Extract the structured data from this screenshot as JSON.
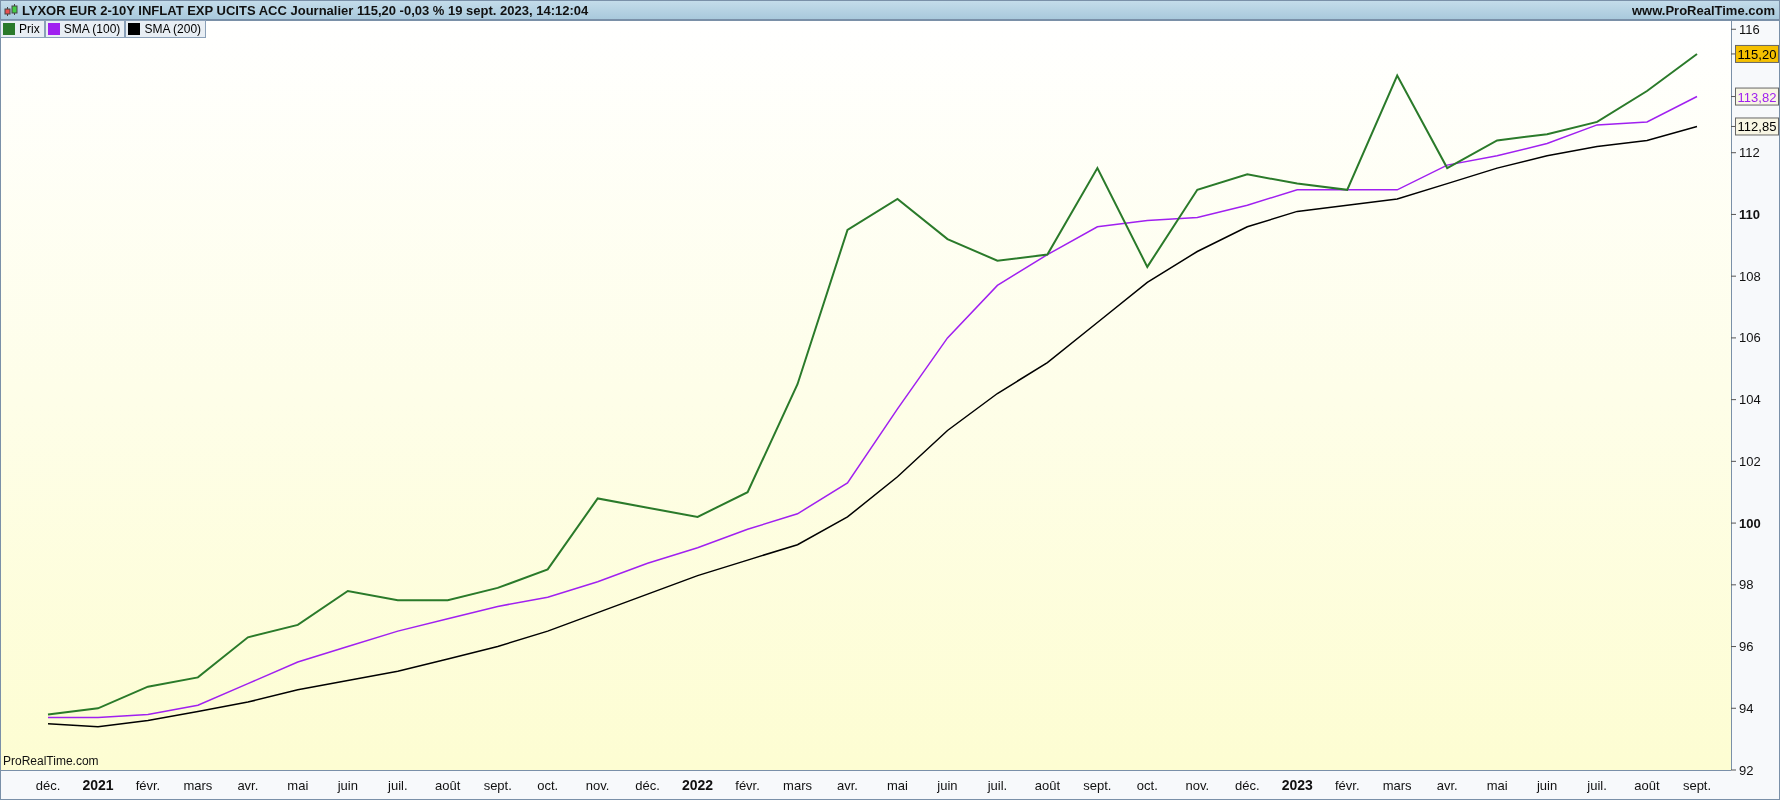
{
  "title_bar": {
    "title": "LYXOR EUR 2-10Y INFLAT EXP UCITS ACC Journalier 115,20 -0,03 % 19 sept. 2023, 14:12:04",
    "website": "www.ProRealTime.com"
  },
  "chart_watermark": "ProRealTime.com",
  "price_badges": [
    {
      "text": "115,20",
      "kind": "highlight"
    },
    {
      "text": "113,82",
      "kind": "plain"
    },
    {
      "text": "112,85",
      "kind": "plain"
    }
  ],
  "chart": {
    "chart_data": {
      "type": "line",
      "categories": [
        "déc.",
        "2021",
        "févr.",
        "mars",
        "avr.",
        "mai",
        "juin",
        "juil.",
        "août",
        "sept.",
        "oct.",
        "nov.",
        "déc.",
        "2022",
        "févr.",
        "mars",
        "avr.",
        "mai",
        "juin",
        "juil.",
        "août",
        "sept.",
        "oct.",
        "nov.",
        "déc.",
        "2023",
        "févr.",
        "mars",
        "avr.",
        "mai",
        "juin",
        "juil.",
        "août",
        "sept."
      ],
      "series": [
        {
          "name": "Prix",
          "color": "#2a7a2a",
          "values": [
            93.8,
            94.0,
            94.7,
            95.0,
            96.3,
            96.7,
            97.8,
            97.5,
            97.5,
            97.9,
            98.5,
            100.8,
            100.5,
            100.2,
            101.0,
            104.5,
            109.5,
            110.5,
            109.2,
            108.5,
            108.7,
            111.5,
            108.3,
            110.8,
            111.3,
            111.0,
            110.8,
            114.5,
            111.5,
            112.4,
            112.6,
            113.0,
            114.0,
            115.2
          ]
        },
        {
          "name": "SMA (100)",
          "color": "#a020f0",
          "values": [
            93.7,
            93.7,
            93.8,
            94.1,
            94.8,
            95.5,
            96.0,
            96.5,
            96.9,
            97.3,
            97.6,
            98.1,
            98.7,
            99.2,
            99.8,
            100.3,
            101.3,
            103.7,
            106.0,
            107.7,
            108.7,
            109.6,
            109.8,
            109.9,
            110.3,
            110.8,
            110.8,
            110.8,
            111.6,
            111.9,
            112.3,
            112.9,
            113.0,
            113.82
          ]
        },
        {
          "name": "SMA (200)",
          "color": "#000000",
          "values": [
            93.5,
            93.4,
            93.6,
            93.9,
            94.2,
            94.6,
            94.9,
            95.2,
            95.6,
            96.0,
            96.5,
            97.1,
            97.7,
            98.3,
            98.8,
            99.3,
            100.2,
            101.5,
            103.0,
            104.2,
            105.2,
            106.5,
            107.8,
            108.8,
            109.6,
            110.1,
            110.3,
            110.5,
            111.0,
            111.5,
            111.9,
            112.2,
            112.4,
            112.85
          ]
        }
      ],
      "ylim": [
        92,
        116.3
      ],
      "yticks": [
        92,
        94,
        96,
        98,
        100,
        102,
        104,
        106,
        108,
        110,
        112,
        116
      ]
    }
  }
}
